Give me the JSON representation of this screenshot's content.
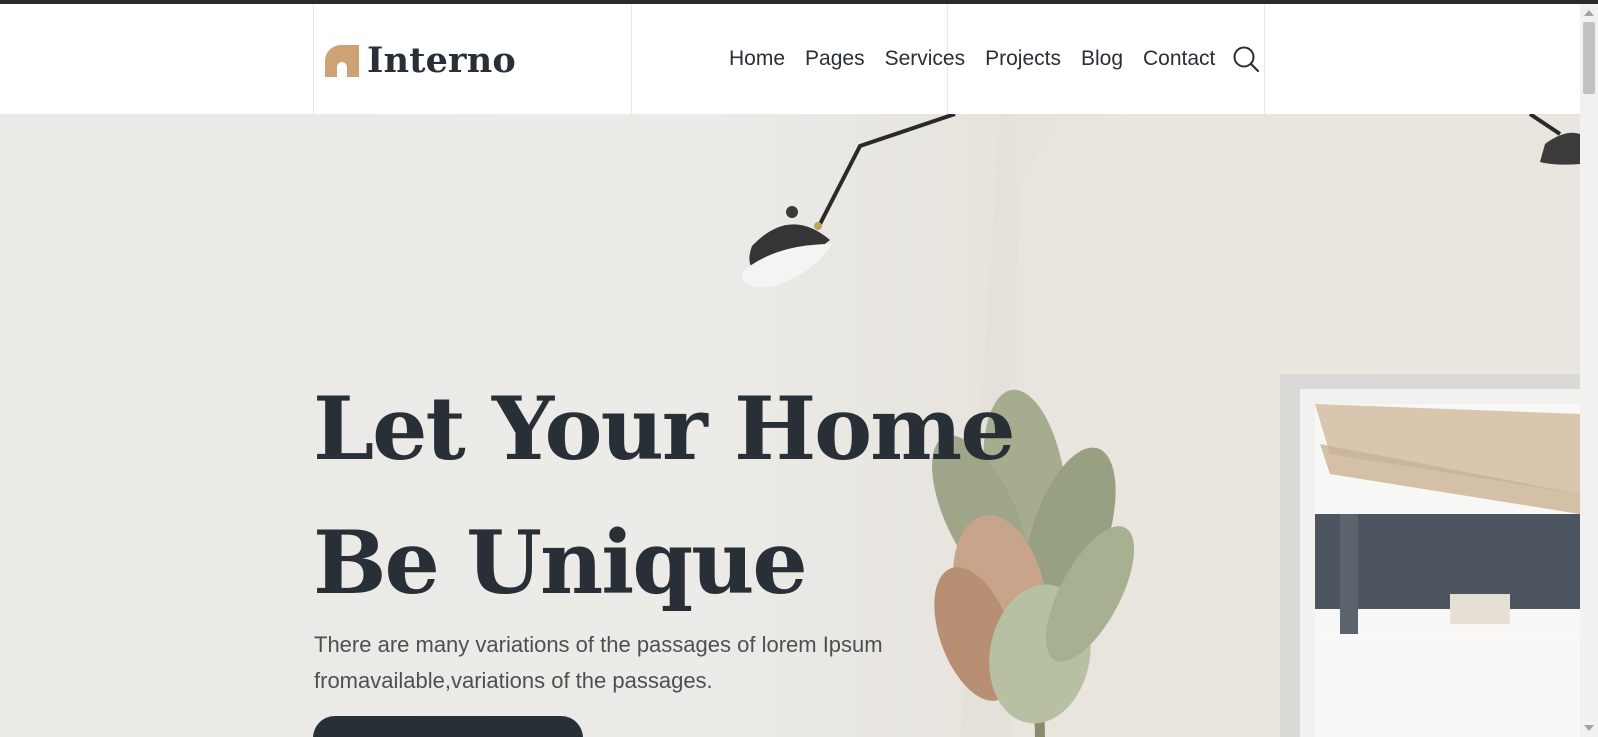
{
  "brand": {
    "name": "Interno",
    "accent_color": "#cda274",
    "text_color": "#292f36"
  },
  "nav": {
    "items": [
      {
        "label": "Home"
      },
      {
        "label": "Pages"
      },
      {
        "label": "Services"
      },
      {
        "label": "Projects"
      },
      {
        "label": "Blog"
      },
      {
        "label": "Contact"
      }
    ],
    "search_icon": "search-icon"
  },
  "hero": {
    "title_line1": "Let Your Home",
    "title_line2": "Be Unique",
    "text_line1": "There are many variations of the passages of lorem Ipsum",
    "text_line2": "fromavailable,variations of the passages.",
    "background": "interior room photo with wall lamp, dried palm leaves plant and window",
    "cta_color": "#292f36"
  }
}
